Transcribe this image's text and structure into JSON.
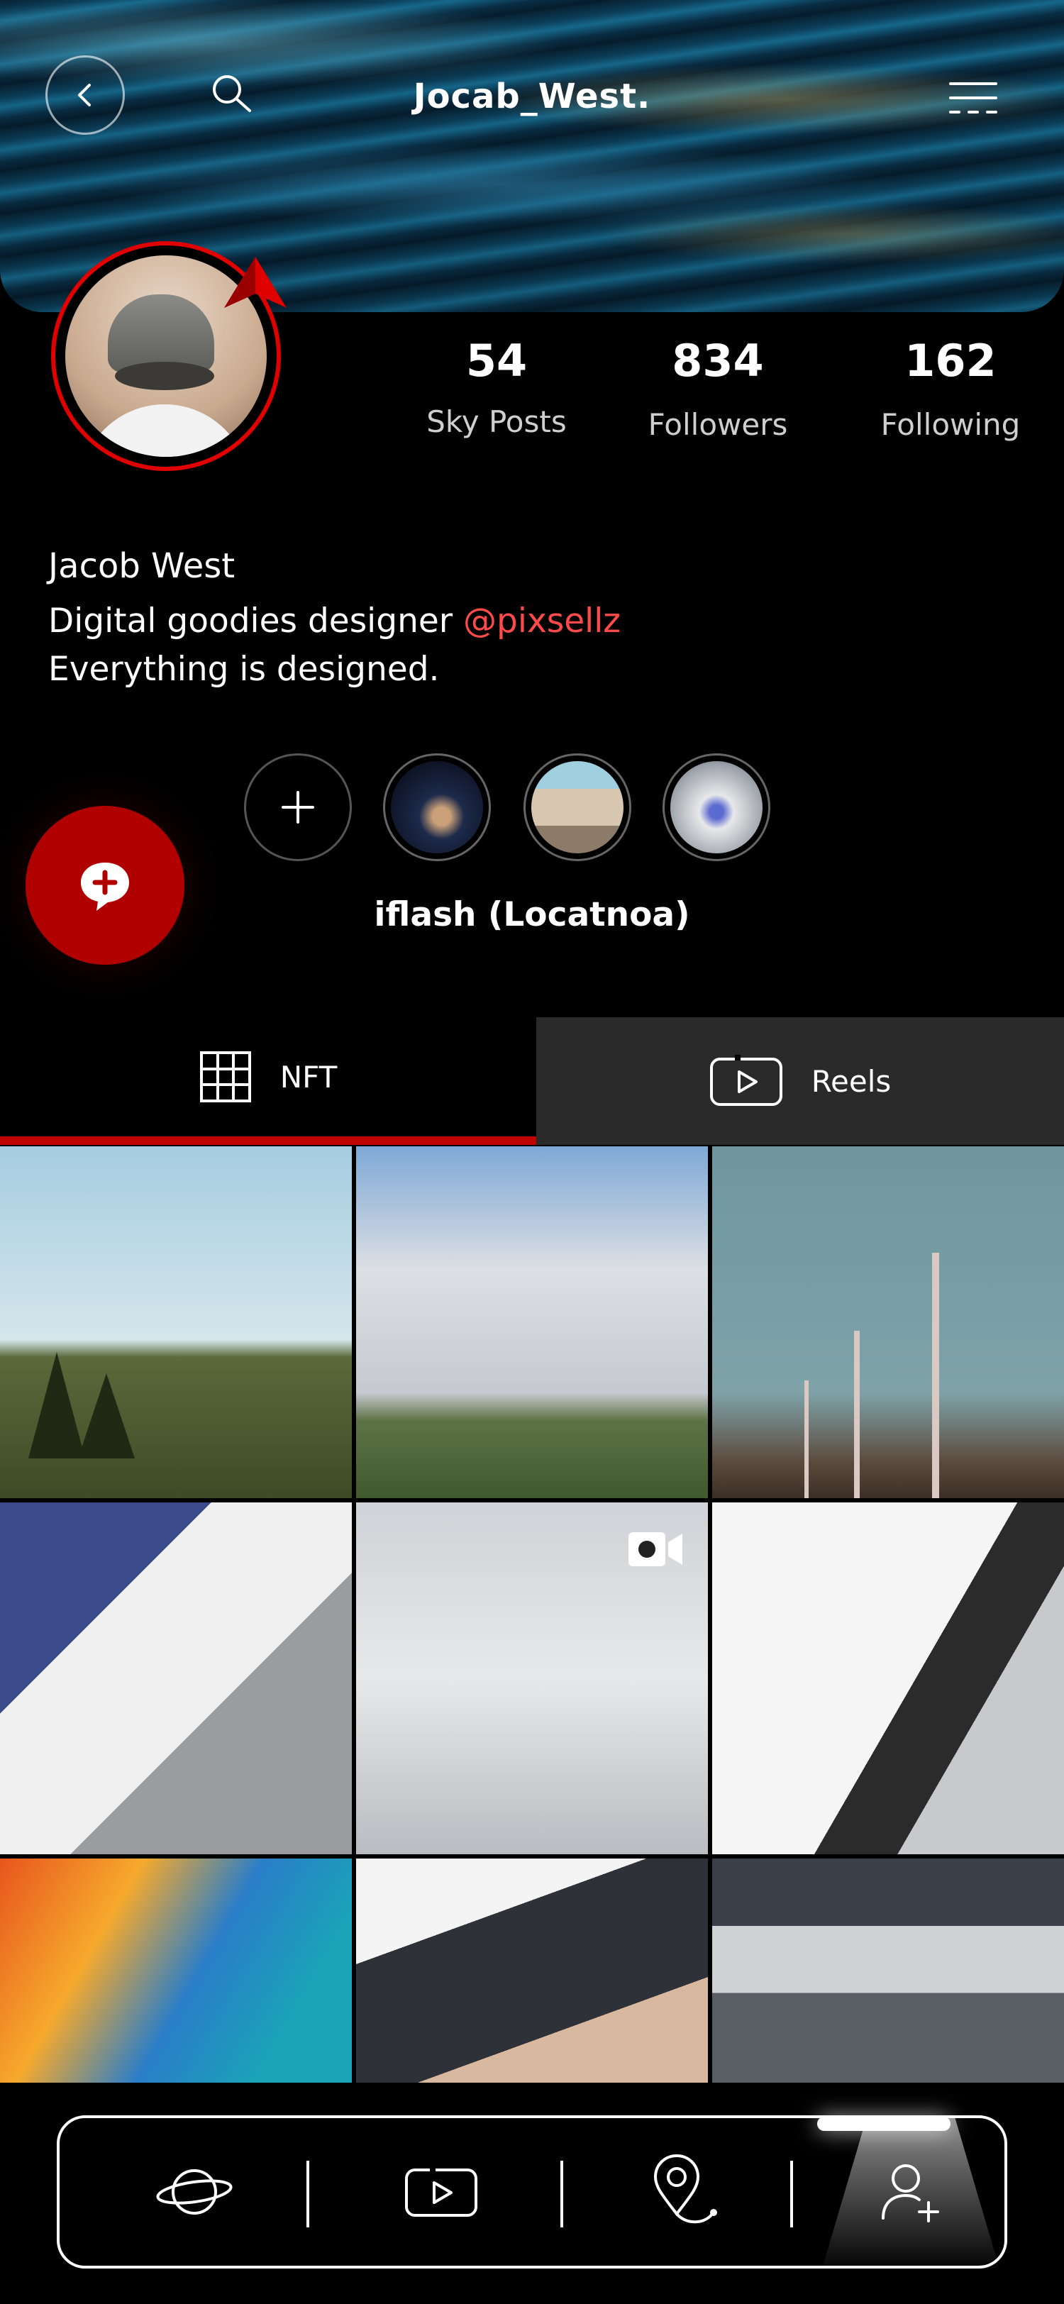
{
  "header": {
    "title": "Jocab_West.",
    "icons": [
      "back-arrow-icon",
      "search-icon",
      "menu-icon"
    ]
  },
  "profile": {
    "name": "Jacob West",
    "bio_line1_text": "Digital goodies designer ",
    "bio_mention": "@pixsellz",
    "bio_line2": "Everything is designed."
  },
  "stats": [
    {
      "value": "54",
      "label": "Sky Posts"
    },
    {
      "value": "834",
      "label": "Followers"
    },
    {
      "value": "162",
      "label": "Following"
    }
  ],
  "highlights": {
    "caption": "iflash (Locatnoa)"
  },
  "tabs": [
    {
      "label": "NFT",
      "icon": "grid-icon",
      "active": true
    },
    {
      "label": "Reels",
      "icon": "reels-icon",
      "active": false
    }
  ],
  "bottom_nav": {
    "items": [
      "explore-planet-icon",
      "reels-icon",
      "location-pin-icon",
      "add-user-icon"
    ],
    "active_index": 3
  },
  "colors": {
    "accent": "#c00000",
    "mention": "#ff4a4a",
    "background": "#000000"
  }
}
